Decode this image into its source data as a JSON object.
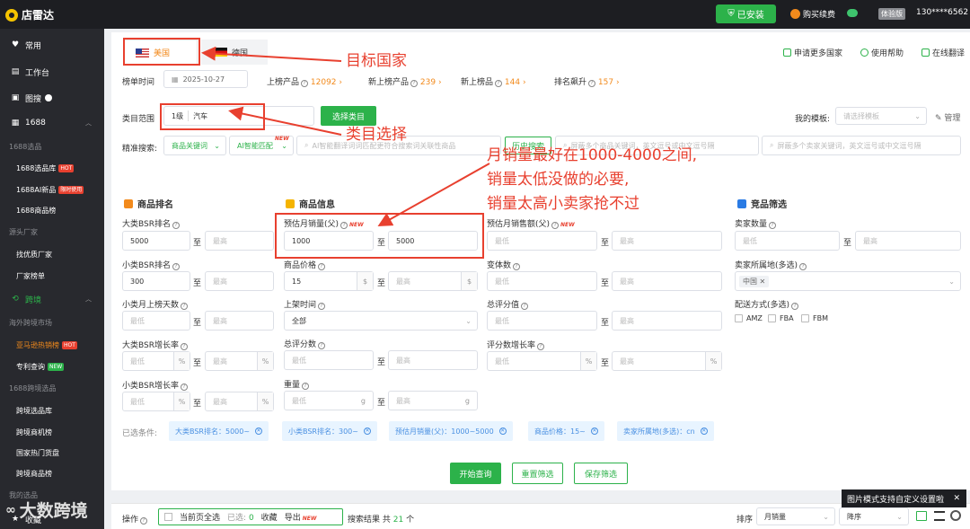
{
  "topbar": {
    "app_name": "店雷达",
    "install_label": "已安装",
    "renew_label": "购买续费",
    "member_badge": "体验版",
    "user_id": "130****6562"
  },
  "sidebar": {
    "items": [
      {
        "icon": "♥",
        "label": "常用"
      },
      {
        "icon": "▤",
        "label": "工作台"
      },
      {
        "icon": "▣",
        "label": "图搜"
      },
      {
        "icon": "▦",
        "label": "1688"
      }
    ],
    "sub_1688": {
      "group": "1688选品",
      "items": [
        "1688选品库",
        "1688AI新品",
        "1688商品榜"
      ],
      "hot": "HOT",
      "limited": "限时使用"
    },
    "source_group": "源头厂家",
    "source_items": [
      "找优质厂家",
      "厂家榜单"
    ],
    "cross_label": "跨境",
    "overseas_group": "海外跨境市场",
    "amazon_item": "亚马逊热销榜",
    "patent_item": "专利查询",
    "new_badge": "NEW",
    "cross_group": "1688跨境选品",
    "cross_items": [
      "跨境选品库",
      "跨境商机榜",
      "国家热门货盘",
      "跨境商品榜"
    ],
    "my_group": "我的选品",
    "collect": "收藏"
  },
  "tabs": {
    "us": "美国",
    "de": "德国"
  },
  "header_links": [
    "申请更多国家",
    "使用帮助",
    "在线翻译"
  ],
  "rank_row": {
    "rank_time_label": "榜单时间",
    "rank_time_value": "2025-10-27",
    "on_label": "上榜产品",
    "on_value": "12092",
    "new_label": "新上榜产品",
    "new_value": "239",
    "new_rank_label": "新上榜品",
    "new_rank_value": "144",
    "rise_label": "排名飙升",
    "rise_value": "157"
  },
  "category": {
    "label": "类目范围",
    "level": "1级",
    "value": "汽车",
    "select_button": "选择类目",
    "template_label": "我的模板:",
    "template_placeholder": "请选择模板",
    "manage": "管理"
  },
  "precise": {
    "label": "精准搜索:",
    "keyword_select": "商品关键词",
    "ai_select": "AI智能匹配",
    "ai_new": "NEW",
    "ai_placeholder": "AI智能翻译词词匹配更符合搜索词关联性商品",
    "history": "历史搜索",
    "kw_placeholder1": "屏蔽多个商品关键词，英文逗号或中文逗号隔",
    "kw_placeholder2": "屏蔽多个卖家关键词，英文逗号或中文逗号隔"
  },
  "sections": {
    "rank": "商品排名",
    "info": "商品信息",
    "competition": "竞品筛选"
  },
  "fields": {
    "big_bsr": "大类BSR排名",
    "big_bsr_min": "5000",
    "small_bsr": "小类BSR排名",
    "small_bsr_min": "300",
    "small_days": "小类月上榜天数",
    "big_bsr_growth": "大类BSR增长率",
    "small_bsr_growth": "小类BSR增长率",
    "monthly_sales": "预估月销量(父)",
    "monthly_sales_min": "1000",
    "monthly_sales_max": "5000",
    "price": "商品价格",
    "price_min": "15",
    "launch": "上架时间",
    "launch_value": "全部",
    "rating": "总评分数",
    "weight": "重量",
    "monthly_revenue": "预估月销售额(父)",
    "variants": "变体数",
    "total_score": "总评分值",
    "review_growth": "评分数增长率",
    "seller_count": "卖家数量",
    "seller_loc": "卖家所属地(多选)",
    "seller_loc_tag": "中国",
    "delivery": "配送方式(多选)",
    "min": "最低",
    "max": "最高",
    "to": "至",
    "pct": "%",
    "dollar": "$",
    "g": "g",
    "new": "NEW"
  },
  "delivery_options": [
    "AMZ",
    "FBA",
    "FBM"
  ],
  "selected": {
    "label": "已选条件:",
    "chips": [
      "大类BSR排名：5000~",
      "小类BSR排名：300~",
      "预估月销量(父)：1000~5000",
      "商品价格：15~",
      "卖家所属地(多选)：cn"
    ]
  },
  "actions": {
    "search": "开始查询",
    "reset": "重置筛选",
    "save": "保存筛选"
  },
  "bottom": {
    "op_label": "操作",
    "select_all": "当前页全选",
    "selected_label": "已选:",
    "selected_count": "0",
    "collect": "收藏",
    "export": "导出",
    "result_label": "搜索结果 共",
    "result_count": "21",
    "result_unit": "个",
    "sort_label": "排序",
    "sort_field": "月销量",
    "sort_order": "降序"
  },
  "tooltip": "图片模式支持自定义设置啦",
  "watermark": "大数跨境",
  "annotations": {
    "country": "目标国家",
    "category": "类目选择",
    "sales_line1": "月销量最好在1000-4000之间,",
    "sales_line2": "销量太低没做的必要,",
    "sales_line3": "销量太高小卖家抢不过"
  }
}
